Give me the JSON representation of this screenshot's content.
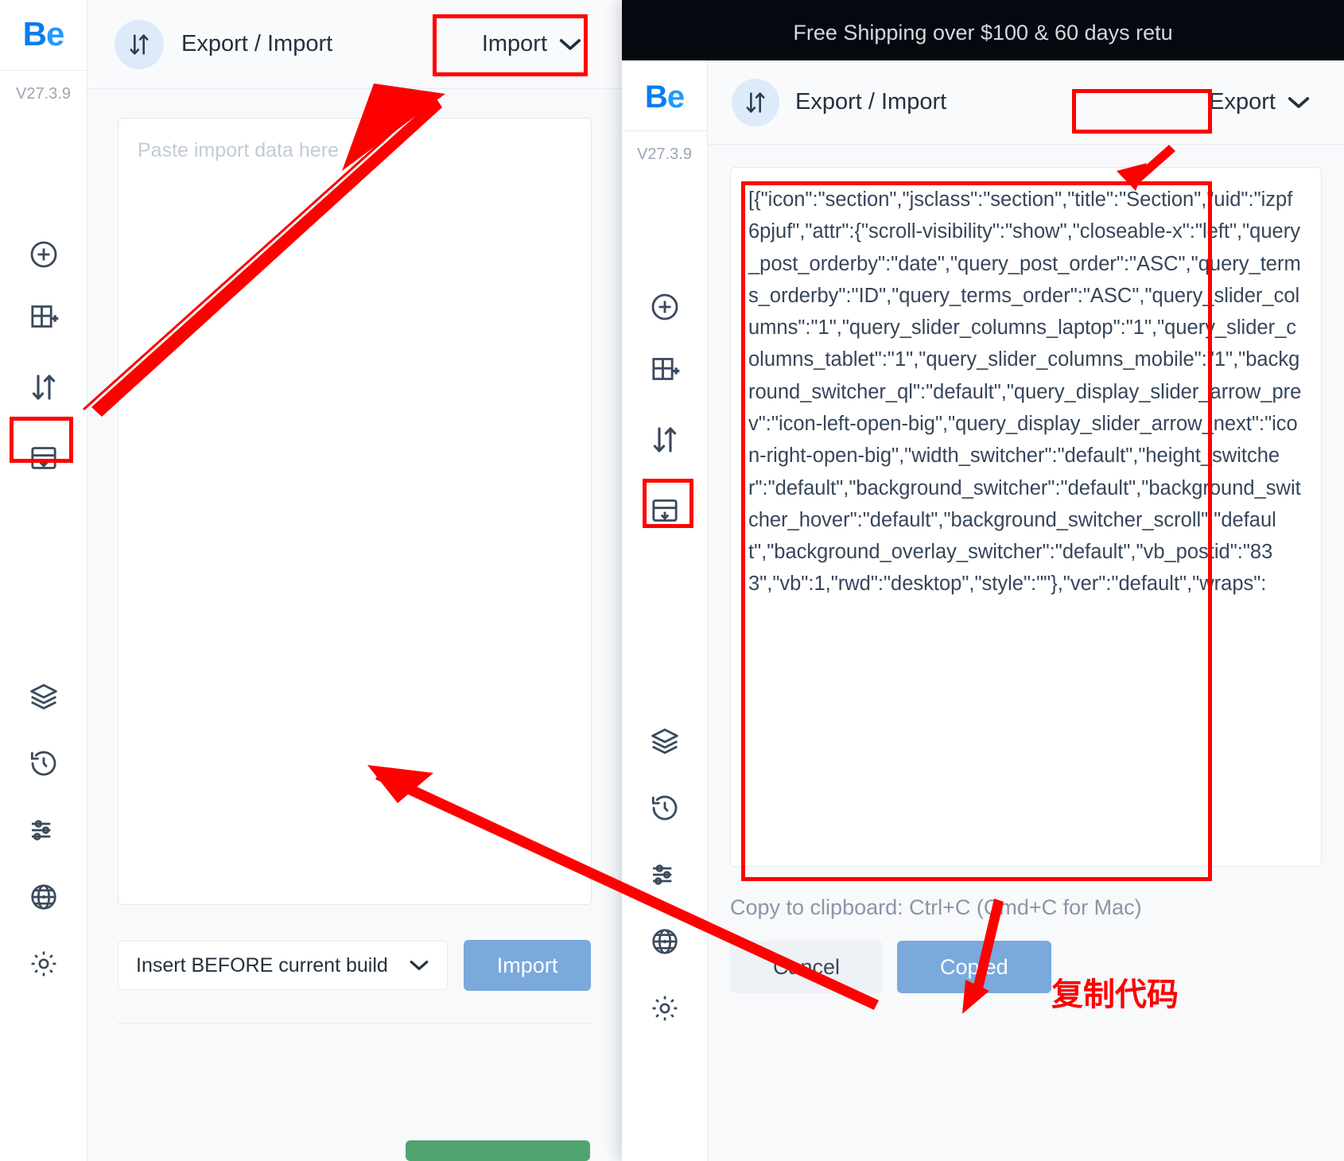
{
  "brand": {
    "text": "Be",
    "b": "B",
    "e": "e"
  },
  "version_label": "V27.3.9",
  "left_panel": {
    "header": {
      "icon": "import-export-icon",
      "title": "Export / Import",
      "mode_select": "Import",
      "chevron": "chevron-down-icon"
    },
    "textarea": {
      "placeholder": "Paste import data here",
      "value": ""
    },
    "position_select": "Insert BEFORE current build",
    "import_button": "Import",
    "rail_icons": [
      "add-element-icon",
      "add-section-icon",
      "import-export-icon",
      "templates-icon",
      "layers-icon",
      "history-icon",
      "settings-sliders-icon",
      "globe-icon",
      "gear-icon"
    ]
  },
  "right_window": {
    "promo_bar": "Free Shipping over $100 & 60 days retu",
    "site_text_1": "F",
    "site_text_2": "s"
  },
  "right_panel": {
    "header": {
      "icon": "import-export-icon",
      "title": "Export / Import",
      "mode_select": "Export",
      "chevron": "chevron-down-icon"
    },
    "textarea": {
      "value": "[{\"icon\":\"section\",\"jsclass\":\"section\",\"title\":\"Section\",\"uid\":\"izpf6pjuf\",\"attr\":{\"scroll-visibility\":\"show\",\"closeable-x\":\"left\",\"query_post_orderby\":\"date\",\"query_post_order\":\"ASC\",\"query_terms_orderby\":\"ID\",\"query_terms_order\":\"ASC\",\"query_slider_columns\":\"1\",\"query_slider_columns_laptop\":\"1\",\"query_slider_columns_tablet\":\"1\",\"query_slider_columns_mobile\":\"1\",\"background_switcher_ql\":\"default\",\"query_display_slider_arrow_prev\":\"icon-left-open-big\",\"query_display_slider_arrow_next\":\"icon-right-open-big\",\"width_switcher\":\"default\",\"height_switcher\":\"default\",\"background_switcher\":\"default\",\"background_switcher_hover\":\"default\",\"background_switcher_scroll\":\"default\",\"background_overlay_switcher\":\"default\",\"vb_postid\":\"833\",\"vb\":1,\"rwd\":\"desktop\",\"style\":\"\"},\"ver\":\"default\",\"wraps\":"
    },
    "copy_note": "Copy to clipboard: Ctrl+C (Cmd+C for Mac)",
    "cancel_button": "Cancel",
    "copied_button": "Copied",
    "rail_icons": [
      "add-element-icon",
      "add-section-icon",
      "import-export-icon",
      "templates-icon",
      "layers-icon",
      "history-icon",
      "settings-sliders-icon",
      "globe-icon",
      "gear-icon"
    ]
  },
  "annotations": {
    "chinese_caption": "复制代码",
    "highlight_color": "#ff0000",
    "boxes": [
      "import-mode-select-highlight",
      "left-rail-import-export-highlight",
      "export-mode-select-highlight",
      "right-rail-import-export-highlight",
      "export-textarea-highlight"
    ],
    "arrows": [
      "arrow-rail-to-import-select",
      "arrow-right-copied-to-left-textarea",
      "arrow-export-select-to-textarea",
      "arrow-textarea-to-copied-button"
    ]
  }
}
